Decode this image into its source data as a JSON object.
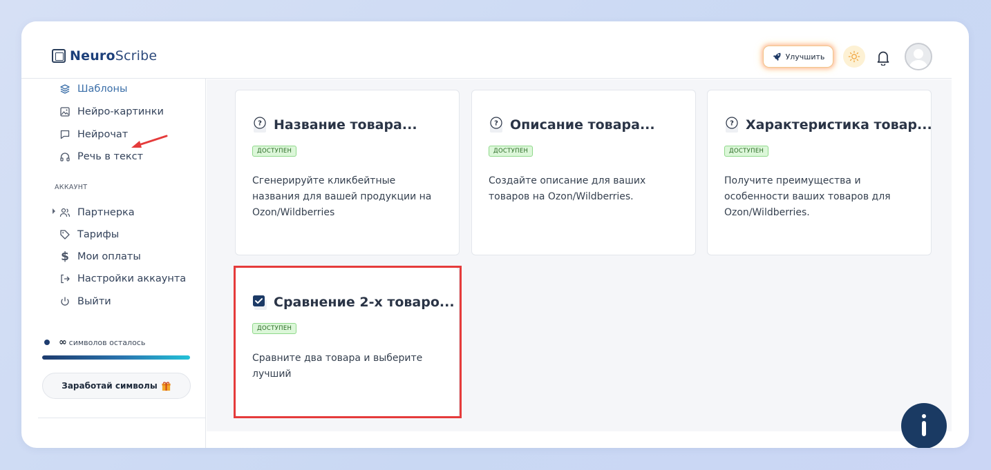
{
  "app": {
    "logo_bold": "Neuro",
    "logo_light": "Scribe"
  },
  "header": {
    "upgrade_label": "Улучшить"
  },
  "sidebar": {
    "items_top": [
      {
        "label": "Шаблоны",
        "icon": "layers-icon",
        "active": true
      },
      {
        "label": "Нейро-картинки",
        "icon": "image-icon"
      },
      {
        "label": "Нейрочат",
        "icon": "chat-icon"
      },
      {
        "label": "Речь в текст",
        "icon": "headphones-icon"
      }
    ],
    "section_label": "АККАУНТ",
    "items_account": [
      {
        "label": "Партнерка",
        "icon": "users-icon"
      },
      {
        "label": "Тарифы",
        "icon": "tag-icon"
      },
      {
        "label": "Мои оплаты",
        "icon": "dollar-icon"
      },
      {
        "label": "Настройки аккаунта",
        "icon": "login-icon"
      },
      {
        "label": "Выйти",
        "icon": "power-icon"
      }
    ],
    "symbols_infinity": "∞",
    "symbols_label": "символов осталось",
    "symbols_progress": 1.0,
    "earn_label": "Заработай символы"
  },
  "cards": [
    {
      "title": "Название товара...",
      "badge": "ДОСТУПЕН",
      "desc": "Сгенерируйте кликбейтные названия для вашей продукции на Ozon/Wildberries",
      "icon": "question-note-icon"
    },
    {
      "title": "Описание товара...",
      "badge": "ДОСТУПЕН",
      "desc": "Создайте описание для ваших товаров на Ozon/Wildberries.",
      "icon": "question-note-icon"
    },
    {
      "title": "Характеристика товар...",
      "badge": "ДОСТУПЕН",
      "desc": "Получите преимущества и особенности ваших товаров для Ozon/Wildberries.",
      "icon": "question-note-icon"
    },
    {
      "title": "Сравнение 2-х товаро...",
      "badge": "ДОСТУПЕН",
      "desc": "Сравните два товара и выберите лучший",
      "icon": "checkbox-note-icon"
    }
  ],
  "colors": {
    "accent": "#3a6ea8",
    "highlight": "#e53b3b",
    "badge_bg": "#dcf7d9",
    "fab": "#1a3a63"
  }
}
